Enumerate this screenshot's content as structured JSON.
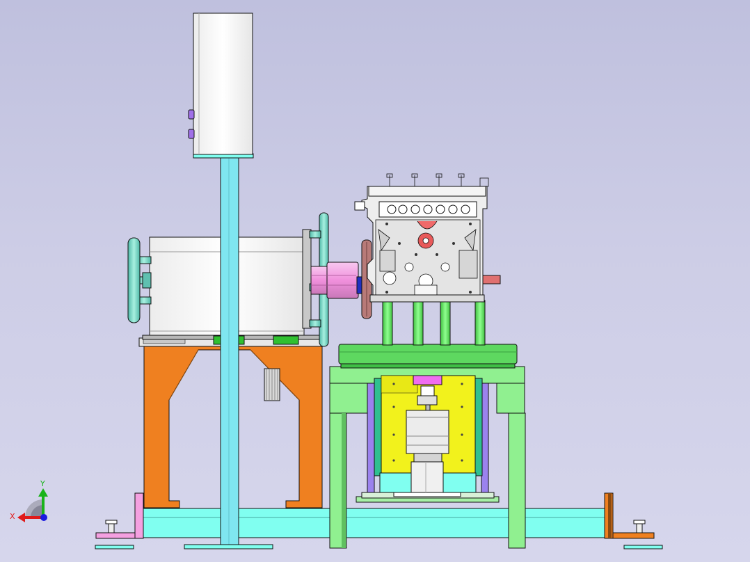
{
  "viewport": {
    "background_top": "#bfc0de",
    "background_bottom": "#d6d6ec"
  },
  "triad": {
    "x_label": "X",
    "y_label": "Y",
    "x_color": "#e01a1a",
    "y_color": "#19b319",
    "z_color": "#1a1ae0"
  },
  "colors": {
    "base_cyan": "#80fff0",
    "column_cyan": "#7fe6f0",
    "orange_stand": "#ef8020",
    "green_frame": "#90f090",
    "turntable_green": "#5ed860",
    "fixture_yellow": "#f2f21c",
    "purple_rail": "#9b82ee",
    "pink_shaft": "#f4a0e0",
    "handwheel_teal": "#7ad8c8",
    "box_white": "#ffffff",
    "engine_gray": "#d8d8d8",
    "outline": "#111111"
  }
}
